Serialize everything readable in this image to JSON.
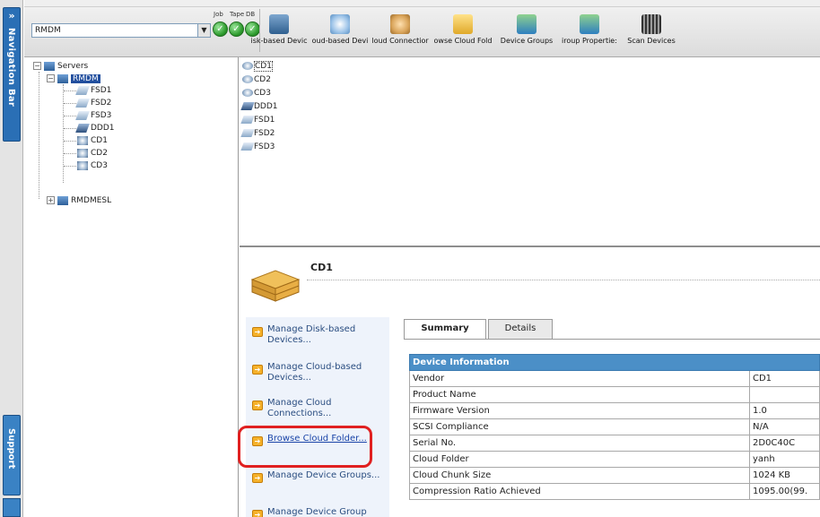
{
  "nav": {
    "navigation_bar": "Navigation Bar",
    "support": "Support",
    "arrows": "»"
  },
  "toolbar": {
    "server_value": "RMDM",
    "status_labels": [
      "Job",
      "Tape",
      "DB"
    ],
    "buttons": [
      "isk-based Devic",
      "oud-based Devi",
      "loud Connectior",
      "owse Cloud Fold",
      "Device Groups",
      "iroup Propertie:",
      "Scan Devices"
    ]
  },
  "tree": {
    "root": "Servers",
    "server": "RMDM",
    "children": [
      "FSD1",
      "FSD2",
      "FSD3",
      "DDD1",
      "CD1",
      "CD2",
      "CD3"
    ],
    "other_server": "RMDMESL"
  },
  "device_list": [
    "CD1",
    "CD2",
    "CD3",
    "DDD1",
    "FSD1",
    "FSD2",
    "FSD3"
  ],
  "detail": {
    "title": "CD1",
    "actions": [
      "Manage Disk-based Devices...",
      "Manage Cloud-based Devices...",
      "Manage Cloud Connections...",
      "Browse Cloud Folder...",
      "Manage Device Groups...",
      "Manage Device Group"
    ],
    "tabs": [
      "Summary",
      "Details"
    ],
    "table_header": "Device Information",
    "rows": [
      {
        "label": "Vendor",
        "value": "CD1"
      },
      {
        "label": "Product Name",
        "value": ""
      },
      {
        "label": "Firmware Version",
        "value": "1.0"
      },
      {
        "label": "SCSI Compliance",
        "value": "N/A"
      },
      {
        "label": "Serial No.",
        "value": "2D0C40C"
      },
      {
        "label": "Cloud Folder",
        "value": "yanh"
      },
      {
        "label": "Cloud Chunk Size",
        "value": "1024 KB"
      },
      {
        "label": "Compression Ratio Achieved",
        "value": "1095.00(99."
      }
    ]
  },
  "colors": {
    "accent": "#2a6fb5",
    "table_header": "#4b8fc7",
    "highlight": "#e02020",
    "status_ok": "#2d9a2d"
  }
}
